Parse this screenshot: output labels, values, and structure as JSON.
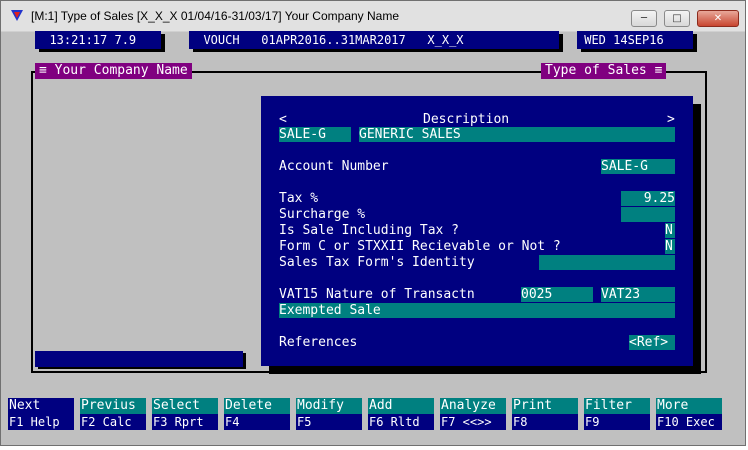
{
  "window": {
    "title": "[M:1]  Type of Sales  [X_X_X  01/04/16-31/03/17]  Your Company Name",
    "minimize": "─",
    "maximize": "□",
    "close": "✕"
  },
  "status": {
    "time": "  13:21:17 7.9",
    "mode": "  VOUCH   01APR2016..31MAR2017   X_X_X",
    "date": " WED 14SEP16"
  },
  "frame": {
    "left_tag": "≡ Your Company Name",
    "right_tag": "Type of Sales ≡"
  },
  "form": {
    "header_left": "<",
    "header_title": "Description",
    "header_right": ">",
    "code": "SALE-G",
    "description": "GENERIC SALES",
    "account_label": "Account Number",
    "account_value": "SALE-G",
    "tax_label": "Tax %",
    "tax_value": "9.25",
    "surcharge_label": "Surcharge %",
    "surcharge_value": "",
    "including_label": "Is Sale Including Tax ?",
    "including_value": "N",
    "formc_label": "Form C or STXXII Recievable or Not ?",
    "formc_value": "N",
    "form_identity_label": "Sales Tax Form's Identity",
    "form_identity_value": "",
    "vat_label": "VAT15 Nature of Transactn",
    "vat_code": "0025",
    "vat_type": "VAT23",
    "vat_desc": "Exempted Sale",
    "references_label": "References",
    "references_value": "<Ref>"
  },
  "fkeys": [
    {
      "top": "Next",
      "bottom": "F1 Help"
    },
    {
      "top": "Previus",
      "bottom": "F2 Calc"
    },
    {
      "top": "Select",
      "bottom": "F3 Rprt"
    },
    {
      "top": "Delete",
      "bottom": "F4"
    },
    {
      "top": "Modify",
      "bottom": "F5"
    },
    {
      "top": "Add",
      "bottom": "F6 Rltd"
    },
    {
      "top": "Analyze",
      "bottom": "F7 <<>>"
    },
    {
      "top": "Print",
      "bottom": "F8"
    },
    {
      "top": "Filter",
      "bottom": "F9"
    },
    {
      "top": "More",
      "bottom": "F10 Exec"
    }
  ]
}
